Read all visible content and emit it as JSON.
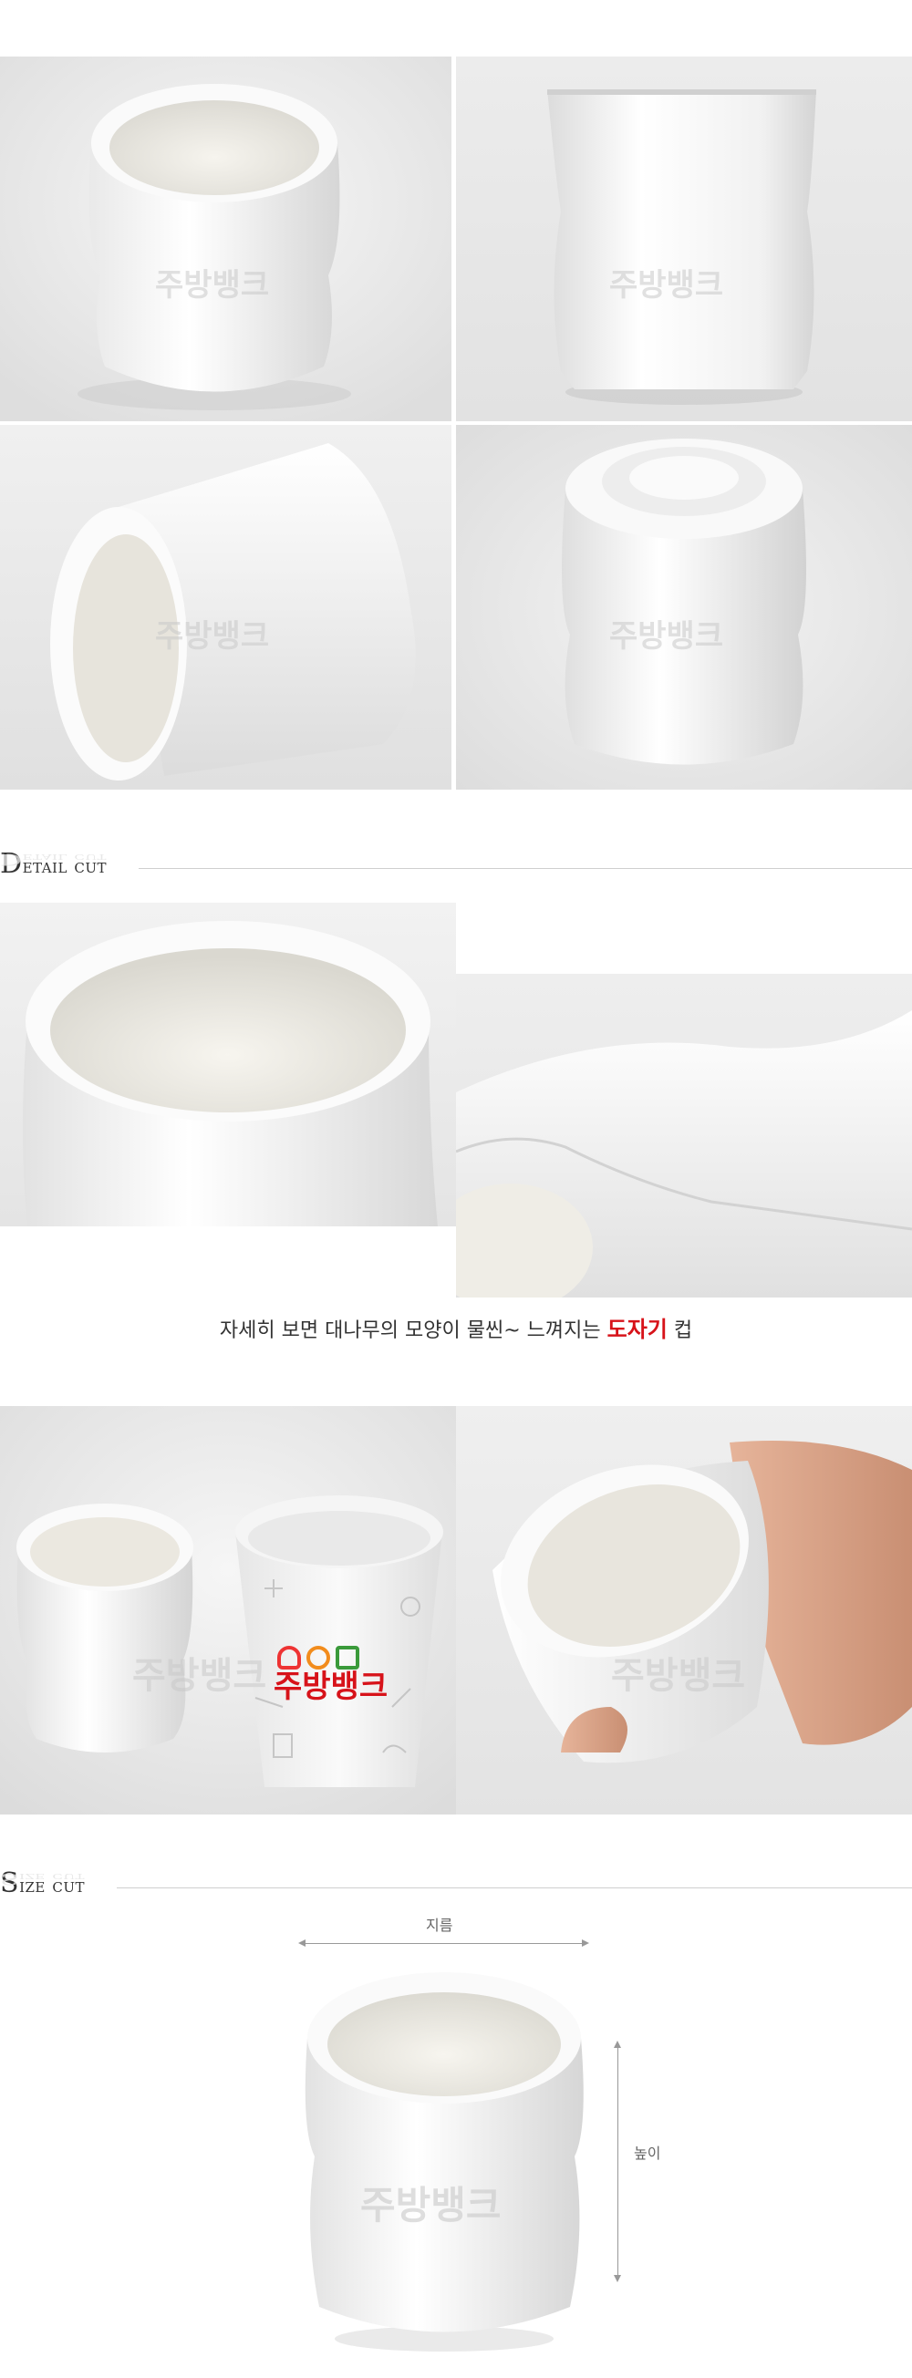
{
  "sections": {
    "detail": {
      "first": "D",
      "rest": "etail cut"
    },
    "size": {
      "first": "S",
      "rest": "ize cut"
    }
  },
  "watermark": "주방뱅크",
  "paper_cup_logo": "주방뱅크",
  "caption": {
    "before": "자세히 보면 대나무의 모양이 물씬~ 느껴지는 ",
    "highlight": "도자기",
    "after": " 컵"
  },
  "dimensions": {
    "diameter_label": "지름",
    "height_label": "높이"
  },
  "colors": {
    "accent": "#d7131a",
    "rule": "#cfcfcf",
    "background_gray": "#e6e6e6"
  }
}
